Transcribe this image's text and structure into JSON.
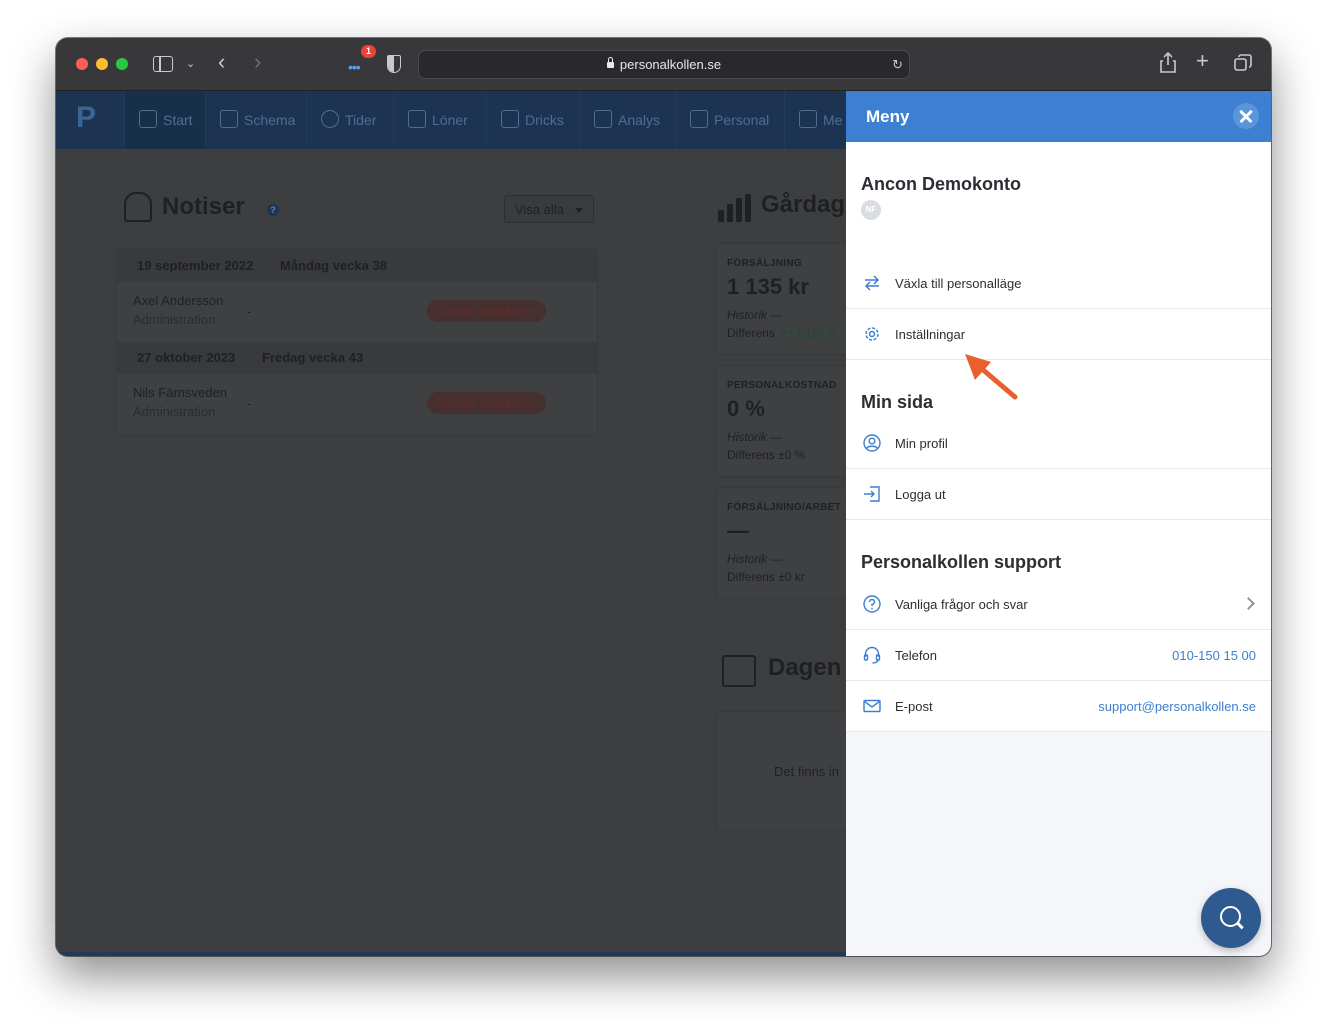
{
  "browser": {
    "url": "personalkollen.se",
    "extension_badge": "1"
  },
  "appnav": {
    "logo": "P",
    "items": [
      {
        "label": "Start",
        "active": true
      },
      {
        "label": "Schema"
      },
      {
        "label": "Tider"
      },
      {
        "label": "Löner"
      },
      {
        "label": "Dricks"
      },
      {
        "label": "Analys"
      },
      {
        "label": "Personal"
      },
      {
        "label": "Me"
      }
    ]
  },
  "notiser": {
    "title": "Notiser",
    "help": "?",
    "filter_label": "Visa alla",
    "groups": [
      {
        "date": "19 september 2022",
        "week": "Måndag vecka 38",
        "rows": [
          {
            "name": "Axel Andersson",
            "role": "Administration",
            "dash": "-",
            "badge": "Saknar bankkonto"
          }
        ]
      },
      {
        "date": "27 oktober 2023",
        "week": "Fredag vecka 43",
        "rows": [
          {
            "name": "Nils Färnsveden",
            "role": "Administration",
            "dash": "-",
            "badge": "Saknar bankkonto"
          }
        ]
      }
    ]
  },
  "gardagen": {
    "title": "Gårdag",
    "cards": [
      {
        "label": "FÖRSÄLJNING",
        "value": "1 135 kr",
        "history": "Historik —",
        "diff_label": "Differens",
        "diff_value": "↗+1 135 k"
      },
      {
        "label": "PERSONALKOSTNAD",
        "value": "0 %",
        "history": "Historik —",
        "diff_label": "Differens ±0 %",
        "diff_value": ""
      },
      {
        "label": "FÖRSÄLJNING/ARBET",
        "value": "—",
        "history": "Historik —",
        "diff_label": "Differens ±0 kr",
        "diff_value": ""
      }
    ]
  },
  "dagen": {
    "title": "Dagen",
    "empty_text": "Det finns in"
  },
  "menu": {
    "title": "Meny",
    "account": {
      "name": "Ancon Demokonto",
      "avatar": "NF"
    },
    "account_items": [
      {
        "label": "Växla till personalläge",
        "icon": "swap-icon"
      },
      {
        "label": "Inställningar",
        "icon": "gear-icon"
      }
    ],
    "min_sida": {
      "heading": "Min sida",
      "items": [
        {
          "label": "Min profil",
          "icon": "user-icon"
        },
        {
          "label": "Logga ut",
          "icon": "logout-icon"
        }
      ]
    },
    "support": {
      "heading": "Personalkollen support",
      "items": [
        {
          "label": "Vanliga frågor och svar",
          "icon": "question-icon",
          "value": ""
        },
        {
          "label": "Telefon",
          "icon": "headset-icon",
          "value": "010-150 15 00"
        },
        {
          "label": "E-post",
          "icon": "mail-icon",
          "value": "support@personalkollen.se"
        }
      ]
    }
  },
  "colors": {
    "menu_header": "#3d7fd0",
    "link": "#3d7fd0",
    "fab": "#2f5a8f",
    "arrow": "#e8602c"
  }
}
